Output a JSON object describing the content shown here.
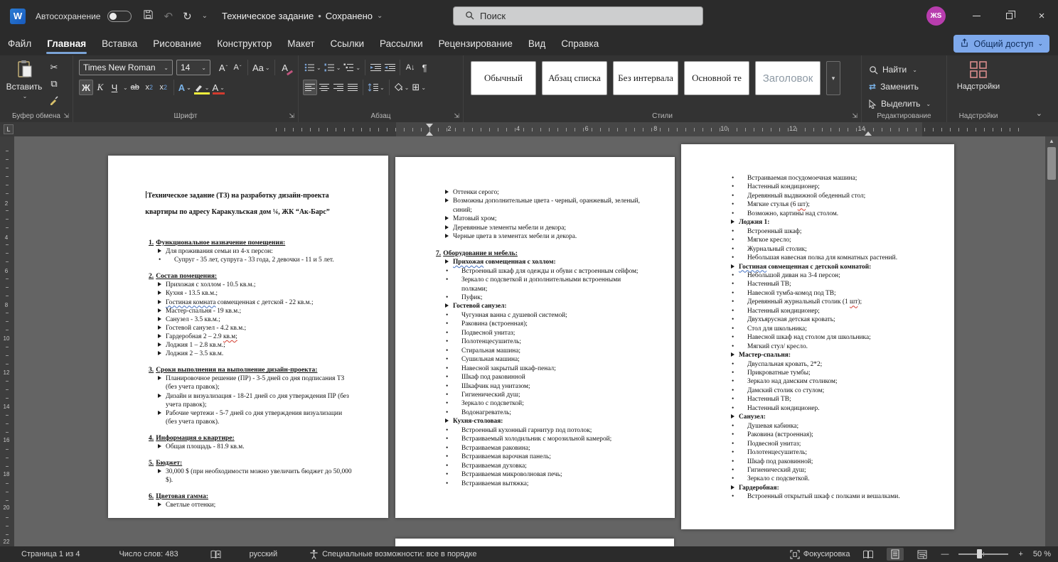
{
  "titlebar": {
    "app_initial": "W",
    "autosave_label": "Автосохранение",
    "doc_title": "Техническое задание",
    "title_sep": "•",
    "doc_status": "Сохранено",
    "search_placeholder": "Поиск",
    "avatar_initials": "ЖS"
  },
  "menu": {
    "tabs": [
      "Файл",
      "Главная",
      "Вставка",
      "Рисование",
      "Конструктор",
      "Макет",
      "Ссылки",
      "Рассылки",
      "Рецензирование",
      "Вид",
      "Справка"
    ],
    "active_tab": "Главная",
    "share_label": "Общий доступ"
  },
  "ribbon": {
    "paste_label": "Вставить",
    "font": {
      "name": "Times New Roman",
      "size": "14"
    },
    "styles": [
      "Обычный",
      "Абзац списка",
      "Без интервала",
      "Основной те",
      "Заголовок"
    ],
    "editing": {
      "find": "Найти",
      "replace": "Заменить",
      "select": "Выделить"
    },
    "addins_label": "Надстройки",
    "groups": {
      "clipboard": "Буфер обмена",
      "font": "Шрифт",
      "paragraph": "Абзац",
      "styles": "Стили",
      "editing": "Редактирование",
      "addins": "Надстройки"
    }
  },
  "glyphs": {
    "bold": "Ж",
    "italic": "К",
    "underline": "Ч",
    "strike": "ab",
    "sub_x": "x",
    "sub_2": "2",
    "sup_x": "x",
    "sup_2": "2",
    "effects": "A",
    "fontcolor": "А",
    "clear": "A",
    "case": "Aa",
    "grow": "А",
    "shrink": "А",
    "up": "ˆ",
    "down": "ˇ",
    "sort": "А↓",
    "pilcrow": "¶",
    "borders": "⊞",
    "replace_arrows": "⇄",
    "cut": "✂",
    "copy": "⧉",
    "undo": "↶",
    "redo": "↻",
    "chevron": "⌄",
    "more": "▾",
    "scroll_up": "▲"
  },
  "ruler": {
    "h_numbers": [
      "2",
      "4",
      "6",
      "8",
      "10",
      "12",
      "14"
    ],
    "v_numbers": [
      "2",
      "4",
      "6",
      "8",
      "10",
      "12",
      "14",
      "16",
      "18",
      "20",
      "22"
    ],
    "tab_selector": "L"
  },
  "statusbar": {
    "page_info": "Страница 1 из 4",
    "word_count": "Число слов: 483",
    "language": "русский",
    "accessibility": "Специальные возможности: все в порядке",
    "focus_label": "Фокусировка",
    "zoom_level": "50 %",
    "zoom_minus": "—",
    "zoom_plus": "+"
  },
  "colors": {
    "share_button": "#7ea9ec",
    "tab_underline": "#7aa3d6",
    "avatar": "#b83dae",
    "addins_icon": "#d98d8d",
    "highlight_bar": "#f1ee3c",
    "font_color_bar": "#d23b2e",
    "word_icon": "#2b7cd3",
    "spell_red": "#d23b2e",
    "grammar_blue": "#4472c4"
  },
  "document": {
    "page1": {
      "blocks": [
        {
          "t": "tl",
          "text": "Техническое задание (ТЗ) на разработку дизайн-проекта",
          "caret": true
        },
        {
          "t": "tl",
          "text": "квартиры по адресу Каракульская дом ¼, ЖК “Ак-Барс”"
        },
        {
          "t": "h",
          "num": "1.",
          "text": "Функциональное назначение помещения:"
        },
        {
          "t": "a",
          "text": "Для проживания семьи из 4-х персон:"
        },
        {
          "t": "b",
          "text": "Супруг - 35 лет, супруга - 33 года, 2 девочки - 11 и 5 лет."
        },
        {
          "t": "h",
          "num": "2.",
          "text": "Состав помещения:"
        },
        {
          "t": "a",
          "text": "Прихожая с холлом - 10.5 кв.м.;"
        },
        {
          "t": "a",
          "text": "Кухня - 13.5 кв.м.;"
        },
        {
          "t": "a",
          "text": "Гостиная комната совмещенная с детской - 22 кв.м.;",
          "m": [
            [
              "Гостиная комната",
              "b"
            ]
          ]
        },
        {
          "t": "a",
          "text": "Мастер-спальня - 19 кв.м.;"
        },
        {
          "t": "a",
          "text": "Санузел - 3.5 кв.м.;"
        },
        {
          "t": "a",
          "text": "Гостевой санузел - 4.2 кв.м.;"
        },
        {
          "t": "a",
          "text": "Гардеробная 2 – 2.9 кв.м;",
          "m": [
            [
              "кв.м;",
              "r"
            ]
          ]
        },
        {
          "t": "a",
          "text": "Лоджия 1 – 2.8 кв.м.;"
        },
        {
          "t": "a",
          "text": "Лоджия 2 – 3.5 кв.м."
        },
        {
          "t": "h",
          "num": "3.",
          "text": "Сроки выполнения на выполнение дизайн-проекта:"
        },
        {
          "t": "a",
          "text": "Планировочное решение (ПР) - 3-5 дней со дня подписания ТЗ (без учета правок);"
        },
        {
          "t": "a",
          "text": "Дизайн и визуализация - 18-21 дней со дня утверждения ПР (без учета правок);"
        },
        {
          "t": "a",
          "text": "Рабочие чертежи - 5-7 дней со дня утверждения визуализации (без учета правок)."
        },
        {
          "t": "h",
          "num": "4.",
          "text": "Информация о квартире:"
        },
        {
          "t": "a",
          "text": "Общая площадь - 81.9 кв.м."
        },
        {
          "t": "h",
          "num": "5.",
          "text": "Бюджет:"
        },
        {
          "t": "a",
          "text": "30,000 $ (при необходимости можно увеличить бюджет до 50,000 $)."
        },
        {
          "t": "h",
          "num": "6.",
          "text": "Цветовая гамма:"
        },
        {
          "t": "a",
          "text": "Светлые оттенки;"
        }
      ]
    },
    "page2": {
      "blocks": [
        {
          "t": "a",
          "text": "Оттенки серого;"
        },
        {
          "t": "a",
          "text": "Возможны дополнительные цвета - черный, оранжевый, зеленый, синий;"
        },
        {
          "t": "a",
          "text": "Матовый хром;"
        },
        {
          "t": "a",
          "text": "Деревянные элементы мебели и декора;"
        },
        {
          "t": "a",
          "text": "Черные цвета в элементах мебели и декора."
        },
        {
          "t": "h",
          "num": "7.",
          "text": "Оборудование и мебель:"
        },
        {
          "t": "a",
          "b": 1,
          "text": "Прихожая совмещенная с холлом:",
          "m": [
            [
              "Прихожая",
              "b"
            ]
          ]
        },
        {
          "t": "b",
          "text": "Встроенный шкаф для одежды и обуви с встроенным сейфом;"
        },
        {
          "t": "b",
          "text": "Зеркало с подсветкой и дополнительными встроенными полками;"
        },
        {
          "t": "b",
          "text": "Пуфик;"
        },
        {
          "t": "a",
          "b": 1,
          "text": "Гостевой санузел:"
        },
        {
          "t": "b",
          "text": "Чугунная ванна с душевой системой;"
        },
        {
          "t": "b",
          "text": "Раковина (встроенная);"
        },
        {
          "t": "b",
          "text": "Подвесной унитаз;"
        },
        {
          "t": "b",
          "text": "Полотенцесушитель;"
        },
        {
          "t": "b",
          "text": "Стиральная машина;"
        },
        {
          "t": "b",
          "text": "Сушильная машина;"
        },
        {
          "t": "b",
          "text": "Навесной закрытый шкаф-пенал;"
        },
        {
          "t": "b",
          "text": "Шкаф под раковинной"
        },
        {
          "t": "b",
          "text": "Шкафчик над унитазом;"
        },
        {
          "t": "b",
          "text": "Гигиенический душ;"
        },
        {
          "t": "b",
          "text": "Зеркало с подсветкой;"
        },
        {
          "t": "b",
          "text": "Водонагреватель;"
        },
        {
          "t": "a",
          "b": 1,
          "text": "Кухня-столовая:"
        },
        {
          "t": "b",
          "text": "Встроенный кухонный гарнитур под потолок;"
        },
        {
          "t": "b",
          "text": "Встраиваемый холодильник с морозильной камерой;"
        },
        {
          "t": "b",
          "text": "Встраиваемая раковина;"
        },
        {
          "t": "b",
          "text": "Встраиваемая варочная панель;"
        },
        {
          "t": "b",
          "text": "Встраиваемая духовка;"
        },
        {
          "t": "b",
          "text": "Встраиваемая микроволновая печь;"
        },
        {
          "t": "b",
          "text": "Встраиваемая вытяжка;"
        }
      ]
    },
    "page3": {
      "blocks": [
        {
          "t": "b",
          "text": "Встраиваемая посудомоечная машина;"
        },
        {
          "t": "b",
          "text": "Настенный кондиционер;"
        },
        {
          "t": "b",
          "text": "Деревянный выдвижной обеденный стол;"
        },
        {
          "t": "b",
          "text": "Мягкие стулья (6 шт);",
          "m": [
            [
              "шт",
              "r"
            ]
          ]
        },
        {
          "t": "b",
          "text": "Возможно, картины над столом."
        },
        {
          "t": "a",
          "b": 1,
          "text": "Лоджия 1:"
        },
        {
          "t": "b",
          "text": "Встроенный шкаф;"
        },
        {
          "t": "b",
          "text": "Мягкое кресло;"
        },
        {
          "t": "b",
          "text": "Журнальный столик;"
        },
        {
          "t": "b",
          "text": "Небольшая навесная полка для комнатных растений."
        },
        {
          "t": "a",
          "b": 1,
          "text": "Гостиная совмещенная с детской комнатой:",
          "m": [
            [
              "Гостиная",
              "b"
            ]
          ]
        },
        {
          "t": "b",
          "text": "Небольшой диван на 3-4 персон;"
        },
        {
          "t": "b",
          "text": "Настенный ТВ;"
        },
        {
          "t": "b",
          "text": "Навесной тумба-комод под ТВ;"
        },
        {
          "t": "b",
          "text": "Деревянный журнальный столик (1 шт);",
          "m": [
            [
              "шт",
              "r"
            ]
          ]
        },
        {
          "t": "b",
          "text": "Настенный кондиционер;"
        },
        {
          "t": "b",
          "text": "Двухъярусная детская кровать;"
        },
        {
          "t": "b",
          "text": "Стол для школьника;"
        },
        {
          "t": "b",
          "text": "Навесной шкаф над столом для школьника;"
        },
        {
          "t": "b",
          "text": "Мягкий стул/ кресло."
        },
        {
          "t": "a",
          "b": 1,
          "text": "Мастер-спальня:"
        },
        {
          "t": "b",
          "text": "Двуспальная кровать, 2*2;"
        },
        {
          "t": "b",
          "text": "Прикроватные тумбы;"
        },
        {
          "t": "b",
          "text": "Зеркало над дамским столиком;"
        },
        {
          "t": "b",
          "text": "Дамский столик со стулом;"
        },
        {
          "t": "b",
          "text": "Настенный ТВ;"
        },
        {
          "t": "b",
          "text": "Настенный кондиционер."
        },
        {
          "t": "a",
          "b": 1,
          "text": "Санузел:"
        },
        {
          "t": "b",
          "text": "Душевая кабинка;"
        },
        {
          "t": "b",
          "text": "Раковина (встроенная);"
        },
        {
          "t": "b",
          "text": "Подвесной унитаз;"
        },
        {
          "t": "b",
          "text": "Полотенцесушитель;"
        },
        {
          "t": "b",
          "text": "Шкаф под раковинной;"
        },
        {
          "t": "b",
          "text": "Гигиенический душ;"
        },
        {
          "t": "b",
          "text": "Зеркало с подсветкой."
        },
        {
          "t": "a",
          "b": 1,
          "text": "Гардеробная:"
        },
        {
          "t": "b",
          "text": "Встроенный открытый шкаф с полками и вешалками."
        }
      ]
    }
  }
}
